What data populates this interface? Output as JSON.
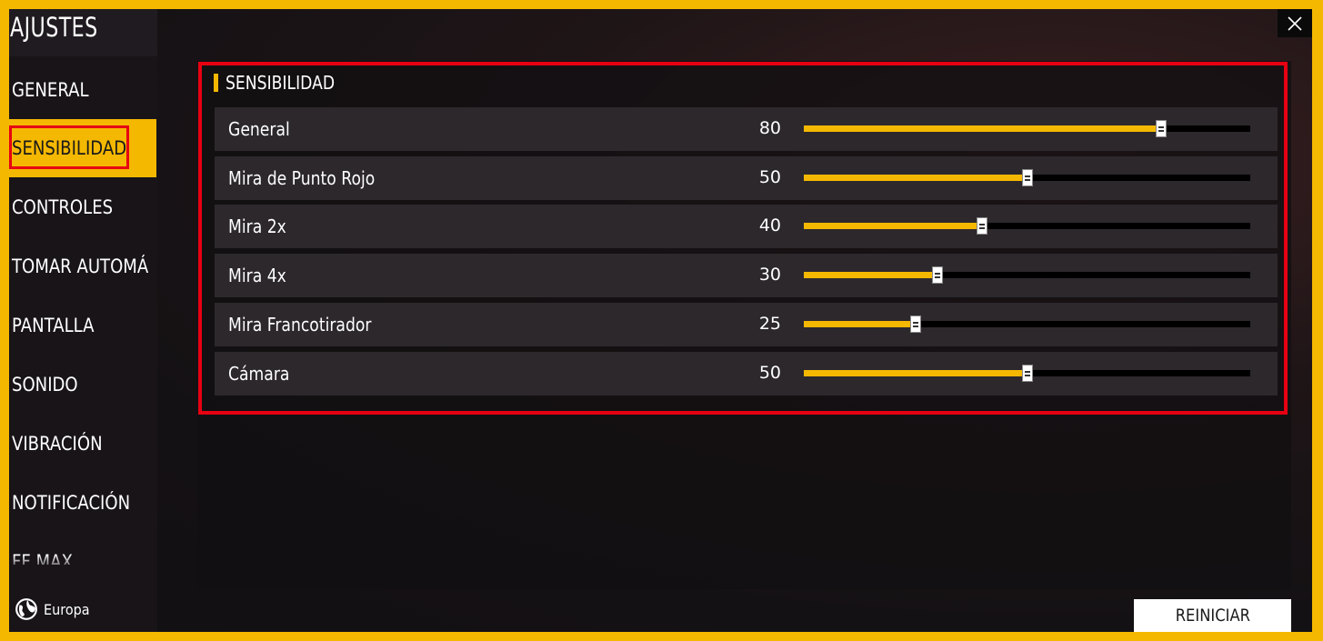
{
  "window": {
    "title": "AJUSTES",
    "close_icon": "close-icon"
  },
  "sidebar": {
    "items": [
      {
        "label": "GENERAL",
        "active": false
      },
      {
        "label": "SENSIBILIDAD",
        "active": true
      },
      {
        "label": "CONTROLES",
        "active": false
      },
      {
        "label": "TOMAR AUTOMÁ",
        "active": false
      },
      {
        "label": "PANTALLA",
        "active": false
      },
      {
        "label": "SONIDO",
        "active": false
      },
      {
        "label": "VIBRACIÓN",
        "active": false
      },
      {
        "label": "NOTIFICACIÓN",
        "active": false
      },
      {
        "label": "FF MAX",
        "active": false
      }
    ],
    "region": {
      "icon": "globe-icon",
      "label": "Europa"
    }
  },
  "section": {
    "title": "SENSIBILIDAD",
    "sliders": [
      {
        "label": "General",
        "value": "80",
        "max": 100
      },
      {
        "label": "Mira de Punto Rojo",
        "value": "50",
        "max": 100
      },
      {
        "label": "Mira 2x",
        "value": "40",
        "max": 100
      },
      {
        "label": "Mira 4x",
        "value": "30",
        "max": 100
      },
      {
        "label": "Mira Francotirador",
        "value": "25",
        "max": 100
      },
      {
        "label": "Cámara",
        "value": "50",
        "max": 100
      }
    ]
  },
  "footer": {
    "reset_label": "REINICIAR"
  },
  "colors": {
    "accent": "#f5b800",
    "highlight": "#e60012",
    "background": "#141114"
  }
}
